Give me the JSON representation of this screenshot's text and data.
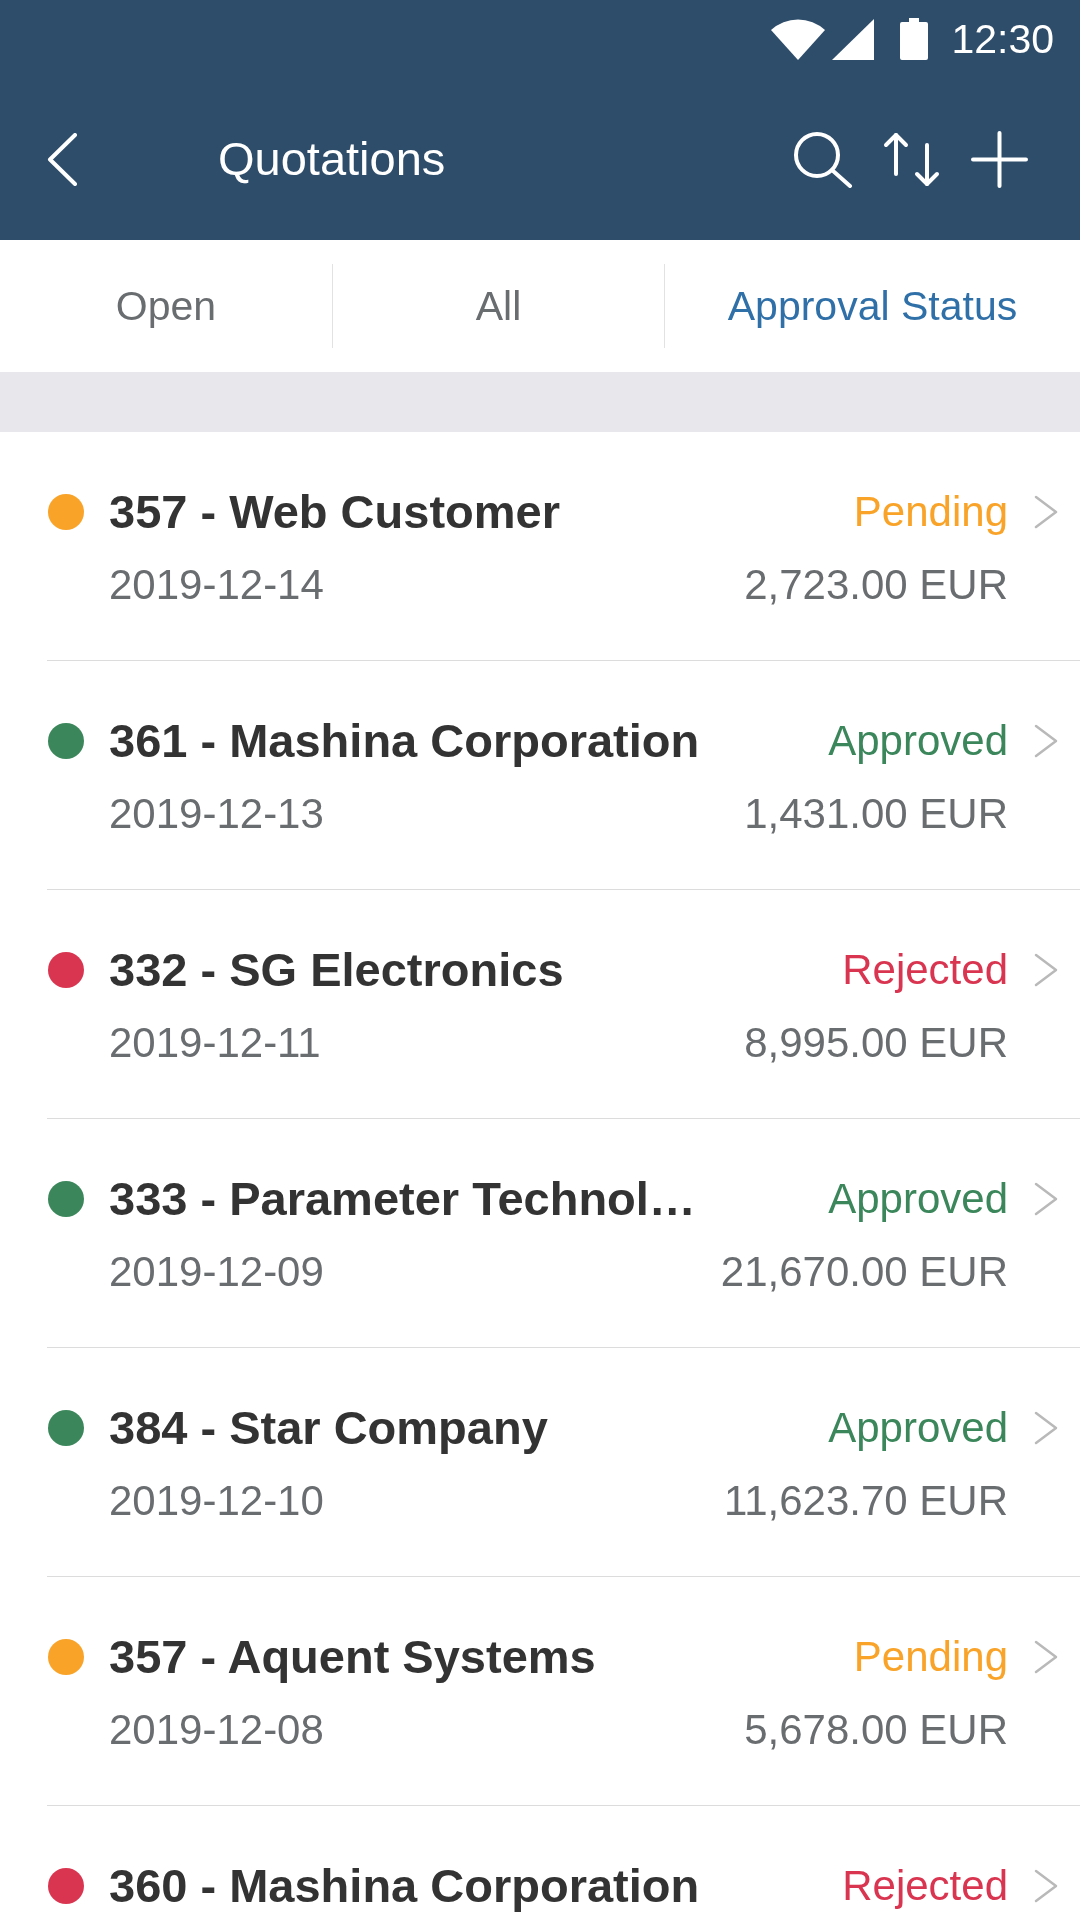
{
  "status_bar": {
    "time": "12:30"
  },
  "app_bar": {
    "title": "Quotations"
  },
  "tabs": [
    {
      "label": "Open",
      "selected": false
    },
    {
      "label": "All",
      "selected": false
    },
    {
      "label": "Approval Status",
      "selected": true
    }
  ],
  "quotations": [
    {
      "title": "357 - Web Customer",
      "status": "Pending",
      "color": "#f9a329",
      "date": "2019-12-14",
      "amount": "2,723.00 EUR"
    },
    {
      "title": "361 - Mashina Corporation",
      "status": "Approved",
      "color": "#3b875b",
      "date": "2019-12-13",
      "amount": "1,431.00 EUR"
    },
    {
      "title": "332 - SG Electronics",
      "status": "Rejected",
      "color": "#da3550",
      "date": "2019-12-11",
      "amount": "8,995.00 EUR"
    },
    {
      "title": "333 - Parameter Technol…",
      "status": "Approved",
      "color": "#3b875b",
      "date": "2019-12-09",
      "amount": "21,670.00 EUR"
    },
    {
      "title": "384 - Star Company",
      "status": "Approved",
      "color": "#3b875b",
      "date": "2019-12-10",
      "amount": "11,623.70 EUR"
    },
    {
      "title": "357 - Aquent Systems",
      "status": "Pending",
      "color": "#f9a329",
      "date": "2019-12-08",
      "amount": "5,678.00 EUR"
    },
    {
      "title": "360 - Mashina Corporation",
      "status": "Rejected",
      "color": "#da3550"
    }
  ]
}
